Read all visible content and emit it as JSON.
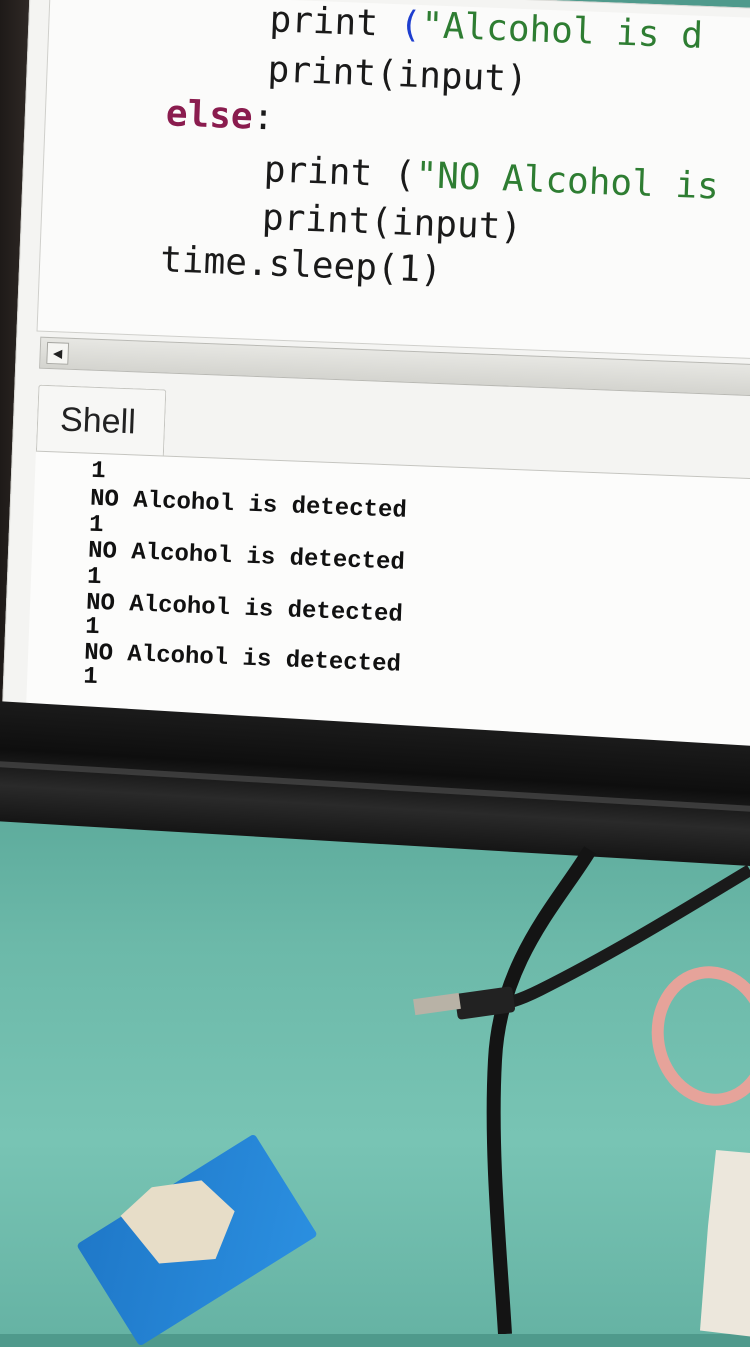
{
  "editor": {
    "lines": [
      {
        "indent": "    ",
        "parts": [
          {
            "t": "print ",
            "c": ""
          },
          {
            "t": "(",
            "c": "paren"
          },
          {
            "t": "\"Alcohol is d",
            "c": "str"
          }
        ]
      },
      {
        "indent": "    ",
        "parts": [
          {
            "t": "print(input)",
            "c": ""
          }
        ]
      },
      {
        "indent": "",
        "parts": [
          {
            "t": "else",
            "c": "kw"
          },
          {
            "t": ":",
            "c": ""
          }
        ]
      },
      {
        "indent": "    ",
        "parts": [
          {
            "t": "print (",
            "c": ""
          },
          {
            "t": "\"NO Alcohol is",
            "c": "str"
          }
        ]
      },
      {
        "indent": "    ",
        "parts": [
          {
            "t": "print(input)",
            "c": ""
          }
        ]
      },
      {
        "indent": "",
        "parts": [
          {
            "t": "time.sleep(1)",
            "c": ""
          }
        ]
      }
    ]
  },
  "shell": {
    "tab_label": "Shell",
    "output": [
      "1",
      "NO Alcohol is detected",
      "1",
      "NO Alcohol is detected",
      "1",
      "NO Alcohol is detected",
      "1",
      "NO Alcohol is detected",
      "1"
    ]
  },
  "colors": {
    "keyword": "#8a1c4e",
    "string": "#2e7d32",
    "paren": "#1e3ecf",
    "desk": "#6cb9a9"
  }
}
